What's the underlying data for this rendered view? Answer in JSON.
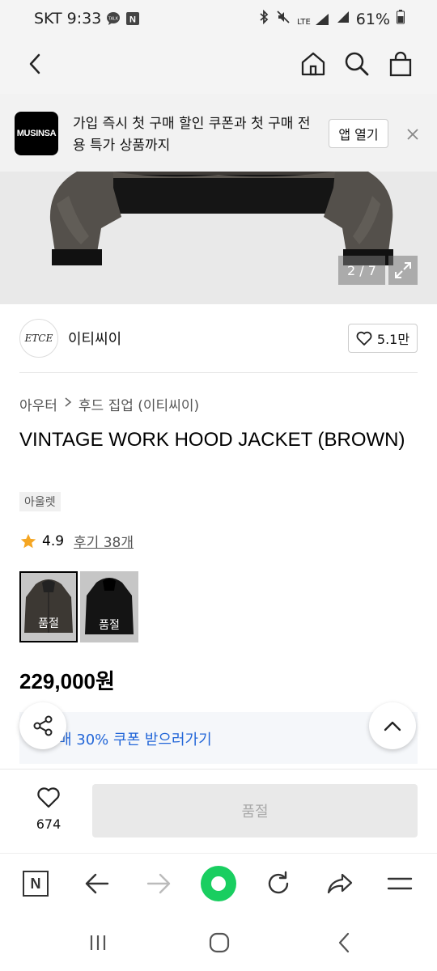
{
  "status_bar": {
    "carrier": "SKT",
    "time": "9:33",
    "talk_badge": "TALK",
    "n_badge": "N",
    "network": "LTE",
    "battery": "61%"
  },
  "promo": {
    "logo_text": "MUSINSA",
    "text": "가입 즉시 첫 구매 할인 쿠폰과 첫 구매 전용 특가 상품까지",
    "open_app": "앱 열기"
  },
  "gallery": {
    "counter": "2 / 7"
  },
  "brand": {
    "logo_text": "ETCE",
    "name": "이티씨이",
    "likes": "5.1만"
  },
  "breadcrumb": {
    "category": "아우터",
    "subcategory": "후드 집업 (이티씨이)"
  },
  "product": {
    "title": "VINTAGE WORK HOOD JACKET (BROWN)",
    "tag": "아울렛",
    "rating": "4.9",
    "reviews": "후기 38개",
    "swatches": [
      {
        "label": "품절"
      },
      {
        "label": "품절"
      }
    ],
    "price": "229,000원",
    "coupon": "매 30% 쿠폰 받으러가기"
  },
  "buy_bar": {
    "like_count": "674",
    "buy_label": "품절"
  },
  "colors": {
    "coupon_blue": "#2266d8",
    "naver_green": "#19ce60",
    "star": "#f5a623"
  }
}
